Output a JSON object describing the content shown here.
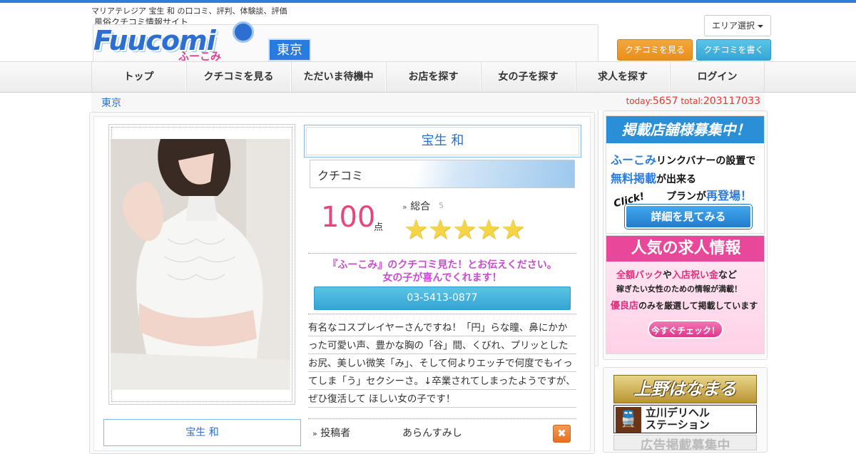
{
  "header": {
    "tagline": "マリアテレジア 宝生 和 の口コミ、評判、体験談、評価",
    "logo_sub": "風俗クチコミ情報サイト",
    "logo_main": "Fuucomi",
    "logo_kana": "ふーこみ",
    "area_badge": "東京",
    "area_select_label": "エリア選択",
    "btn_see_reviews": "クチコミを見る",
    "btn_write_review": "クチコミを書く"
  },
  "nav": {
    "items": [
      {
        "label": "トップ"
      },
      {
        "label": "クチコミを見る"
      },
      {
        "label": "ただいま待機中"
      },
      {
        "label": "お店を探す"
      },
      {
        "label": "女の子を探す"
      },
      {
        "label": "求人を探す"
      },
      {
        "label": "ログイン"
      }
    ]
  },
  "breadcrumb": {
    "area": "東京",
    "today_label": "today:",
    "today_value": "5657",
    "total_label": "total:",
    "total_value": "203117033"
  },
  "profile": {
    "name": "宝生 和",
    "tab_label": "クチコミ",
    "score": "100",
    "score_unit": "点",
    "total_label": "総合",
    "total_count": "5",
    "stars": 5,
    "promo_line1": "『ふーこみ』のクチコミ見た！とお伝えください。",
    "promo_line2": "女の子が喜んでくれます！",
    "phone": "03-5413-0877",
    "description": "有名なコスプレイヤーさんですね！「円」らな瞳、鼻にかかった可愛い声、豊かな胸の「谷」間、くびれ、プリッとしたお尻、美しい微笑「み」、そして何よりエッチで何度でもイってしま「う」セクシーさ。↓卒業されてしまったようですが、ぜひ復活して ほしい女の子です！",
    "name_secondary": "宝生 和",
    "poster_label": "投稿者",
    "poster_name": "あらんすみし",
    "close_symbol": "✖"
  },
  "sidebar": {
    "banner1": {
      "head": "掲載店舗様募集中！",
      "line1_key": "ふーこみ",
      "line1_rest": "リンクバナーの設置で",
      "line2_key": "無料掲載",
      "line2_rest": "が出来る",
      "line3_rest": "プランが",
      "line3_key": "再登場！",
      "click": "Click!",
      "cta": "詳細を見てみる"
    },
    "banner2": {
      "head": "人気の求人情報",
      "line1_key1": "全額バック",
      "line1_mid": "や",
      "line1_key2": "入店祝い金",
      "line1_rest": "など",
      "line2": "稼ぎたい女性のための情報が満載！",
      "line3_key": "優良店",
      "line3_rest": "のみを厳選して掲載しています",
      "cta": "今すぐチェック！"
    },
    "ads": {
      "ad1": "上野はなまる",
      "ad2_line1": "立川デリヘル",
      "ad2_line2": "ステーション",
      "ad3": "広告掲載募集中"
    }
  },
  "colors": {
    "accent_blue": "#2a6fc9",
    "score_pink": "#e8467a",
    "promo_purple": "#c94bd2",
    "orange_button": "#e7901c",
    "cyan_button": "#36a5d3"
  }
}
